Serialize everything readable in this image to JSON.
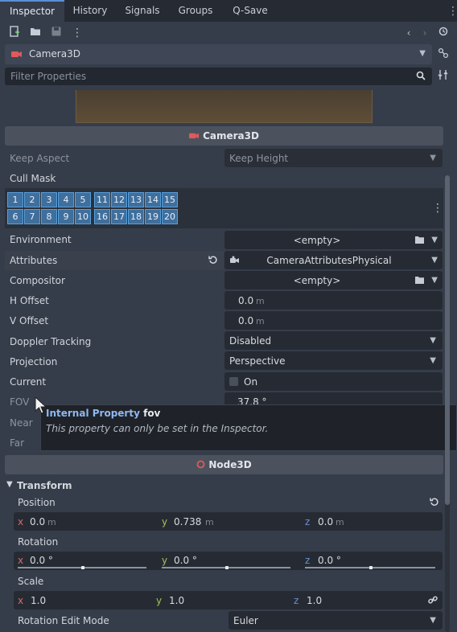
{
  "tabs": [
    "Inspector",
    "History",
    "Signals",
    "Groups",
    "Q-Save"
  ],
  "path": {
    "node_name": "Camera3D"
  },
  "filter": {
    "placeholder": "Filter Properties"
  },
  "camera_section": {
    "title": "Camera3D"
  },
  "props": {
    "keep_aspect": {
      "label": "Keep Aspect",
      "value": "Keep Height"
    },
    "cull_mask": {
      "label": "Cull Mask",
      "row1": [
        "1",
        "2",
        "3",
        "4",
        "5",
        "11",
        "12",
        "13",
        "14",
        "15"
      ],
      "row2": [
        "6",
        "7",
        "8",
        "9",
        "10",
        "16",
        "17",
        "18",
        "19",
        "20"
      ]
    },
    "environment": {
      "label": "Environment",
      "value": "<empty>"
    },
    "attributes": {
      "label": "Attributes",
      "value": "CameraAttributesPhysical"
    },
    "compositor": {
      "label": "Compositor",
      "value": "<empty>"
    },
    "h_offset": {
      "label": "H Offset",
      "value": "0.0",
      "unit": "m"
    },
    "v_offset": {
      "label": "V Offset",
      "value": "0.0",
      "unit": "m"
    },
    "doppler": {
      "label": "Doppler Tracking",
      "value": "Disabled"
    },
    "projection": {
      "label": "Projection",
      "value": "Perspective"
    },
    "current": {
      "label": "Current",
      "value": "On"
    },
    "fov": {
      "label": "FOV",
      "value": "37.8 °"
    },
    "near": {
      "label": "Near"
    },
    "far": {
      "label": "Far"
    }
  },
  "tooltip": {
    "title_link": "Internal Property",
    "title_rest": "fov",
    "body": "This property can only be set in the Inspector."
  },
  "node3d_section": {
    "title": "Node3D"
  },
  "transform": {
    "title": "Transform",
    "position": {
      "label": "Position",
      "x": "0.0",
      "y": "0.738",
      "z": "0.0",
      "unit": "m"
    },
    "rotation": {
      "label": "Rotation",
      "x": "0.0 °",
      "y": "0.0 °",
      "z": "0.0 °"
    },
    "scale": {
      "label": "Scale",
      "x": "1.0",
      "y": "1.0",
      "z": "1.0"
    },
    "rotation_edit_mode": {
      "label": "Rotation Edit Mode",
      "value": "Euler"
    }
  },
  "axis_letters": {
    "x": "x",
    "y": "y",
    "z": "z"
  },
  "icons": [
    "new-resource-icon",
    "open-icon",
    "save-icon",
    "more-icon",
    "back-icon",
    "forward-icon",
    "history-icon",
    "camera-icon",
    "node-tools-icon",
    "search-icon",
    "filter-settings-icon",
    "revert-icon",
    "load-icon",
    "link-icon"
  ],
  "colors": {
    "accent": "#5b8fd6",
    "camera_icon": "#e05a5a",
    "node3d_icon": "#e05a5a",
    "cull_bit": "#3f6f9d"
  }
}
